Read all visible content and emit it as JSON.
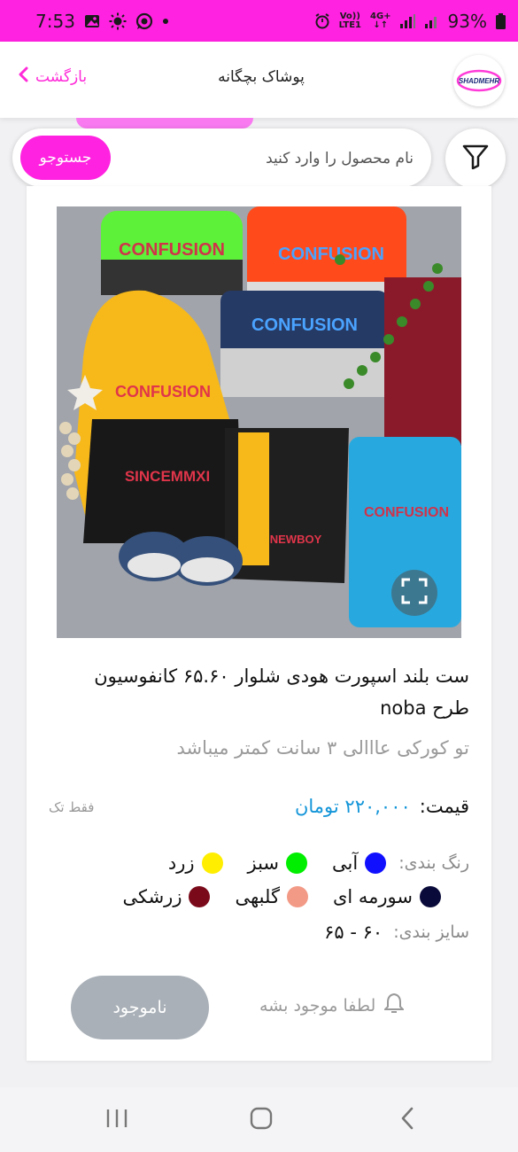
{
  "status_bar": {
    "time": "7:53",
    "network_top": "Vo))",
    "network_bottom": "LTE1",
    "signal_label": "4G+",
    "battery": "93%",
    "background": "#ff22e0"
  },
  "header": {
    "back_label": "بازگشت",
    "title": "پوشاک بچگانه",
    "logo_text": "SHADMEHR"
  },
  "search": {
    "placeholder": "نام محصول را وارد کنید",
    "button_label": "جستوجو"
  },
  "product": {
    "title": "ست بلند اسپورت هودی شلوار ۶۵.۶۰ کانفوسیون طرح noba",
    "description": "تو کورکی عااالی ۳ سانت کمتر میباشد",
    "price_label": "قیمت:",
    "price_value": "۲۲۰,۰۰۰ تومان",
    "single_only": "فقط تک",
    "colors_label": "رنگ بندی:",
    "colors": [
      {
        "name": "آبی",
        "hex": "#1010ff"
      },
      {
        "name": "سبز",
        "hex": "#00ee00"
      },
      {
        "name": "زرد",
        "hex": "#ffee00"
      },
      {
        "name": "سورمه ای",
        "hex": "#0a0a3a"
      },
      {
        "name": "گلبهی",
        "hex": "#f29a86"
      },
      {
        "name": "زرشکی",
        "hex": "#7a0a1a"
      }
    ],
    "sizes_label": "سایز بندی:",
    "sizes_value": "۶۰ - ۶۵",
    "unavailable_label": "ناموجود",
    "notify_label": "لطفا موجود بشه"
  },
  "image_text": {
    "brand_print": "CONFUSION",
    "sweat_print": "SINCEMMXI",
    "pants_print": "NEWBOY"
  }
}
